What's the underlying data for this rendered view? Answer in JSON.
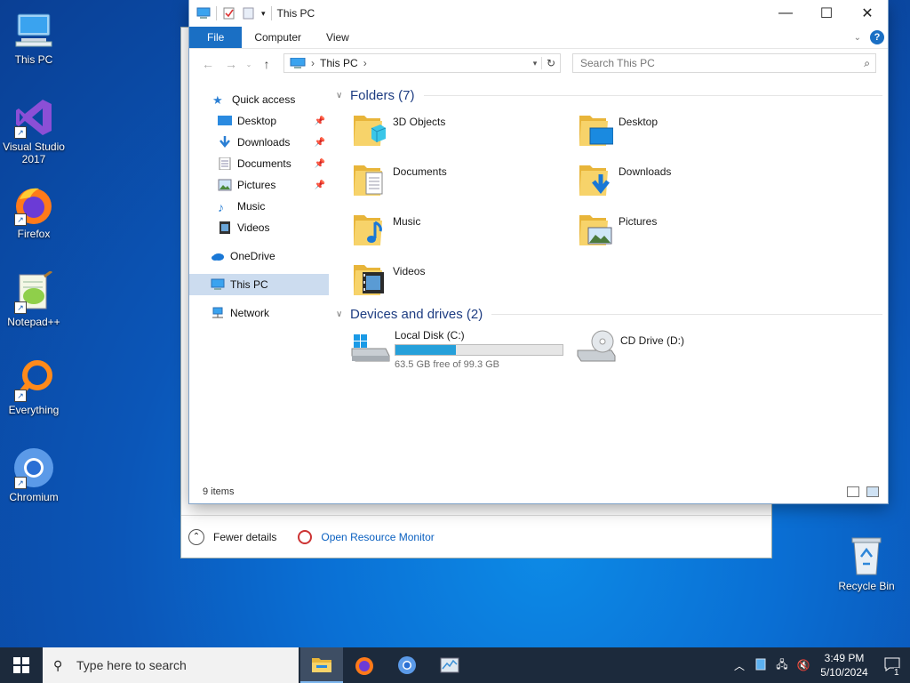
{
  "desktop": {
    "icons": [
      {
        "label": "This PC"
      },
      {
        "label": "Visual Studio 2017"
      },
      {
        "label": "Firefox"
      },
      {
        "label": "Notepad++"
      },
      {
        "label": "Everything"
      },
      {
        "label": "Chromium"
      },
      {
        "label": "Recycle Bin"
      }
    ]
  },
  "taskmgr": {
    "fewer_details": "Fewer details",
    "open_resource_monitor": "Open Resource Monitor"
  },
  "explorer": {
    "title": "This PC",
    "ribbon_tabs": [
      "File",
      "Computer",
      "View"
    ],
    "address": {
      "crumb": "This PC"
    },
    "search_placeholder": "Search This PC",
    "nav": {
      "quick_access": "Quick access",
      "items": [
        "Desktop",
        "Downloads",
        "Documents",
        "Pictures",
        "Music",
        "Videos"
      ],
      "onedrive": "OneDrive",
      "thispc": "This PC",
      "network": "Network"
    },
    "folders_header": "Folders (7)",
    "folders": [
      "3D Objects",
      "Desktop",
      "Documents",
      "Downloads",
      "Music",
      "Pictures",
      "Videos"
    ],
    "devices_header": "Devices and drives (2)",
    "drives": [
      {
        "name": "Local Disk (C:)",
        "free_text": "63.5 GB free of 99.3 GB",
        "used_fraction": 0.36
      },
      {
        "name": "CD Drive (D:)"
      }
    ],
    "status": "9 items"
  },
  "taskbar": {
    "search_placeholder": "Type here to search",
    "time": "3:49 PM",
    "date": "5/10/2024",
    "notification_count": "1"
  },
  "colors": {
    "accent": "#1a6fc4",
    "drive_bar": "#26a0da",
    "taskbar": "#1c2a3c"
  }
}
